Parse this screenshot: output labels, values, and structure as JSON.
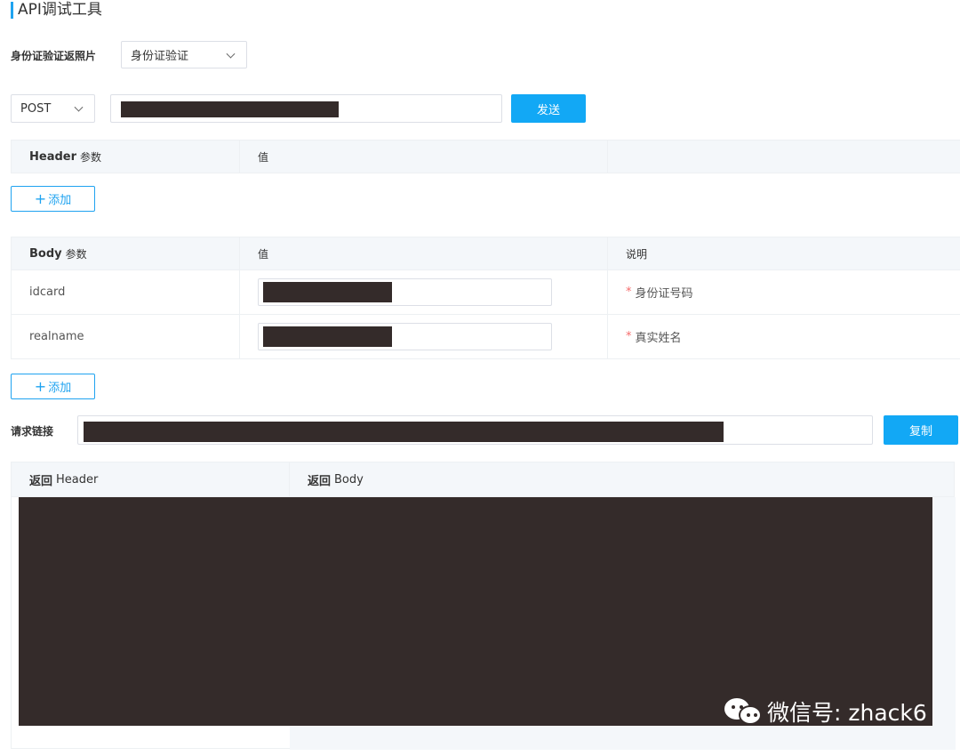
{
  "page": {
    "title": "API调试工具"
  },
  "api_select": {
    "label": "身份证验证返照片",
    "value": "身份证验证"
  },
  "request": {
    "method": "POST",
    "send_label": "发送"
  },
  "header_table": {
    "columns": [
      "Header",
      "参数",
      "值"
    ],
    "add_label": "添加"
  },
  "body_table": {
    "columns": [
      "Body",
      "参数",
      "值",
      "说明"
    ],
    "rows": [
      {
        "param": "idcard",
        "desc": "身份证号码"
      },
      {
        "param": "realname",
        "desc": "真实姓名"
      }
    ],
    "required_mark": "*",
    "add_label": "添加"
  },
  "request_link": {
    "label": "请求链接",
    "copy_label": "复制"
  },
  "response": {
    "header_prefix": "返回",
    "header_label": "Header",
    "body_prefix": "返回",
    "body_label": "Body"
  },
  "watermark": {
    "text": "微信号: zhack6"
  },
  "colors": {
    "accent": "#12a8f5",
    "redaction": "#342b2a",
    "header_bg": "#f4f7fa",
    "required": "#f56c6c"
  }
}
